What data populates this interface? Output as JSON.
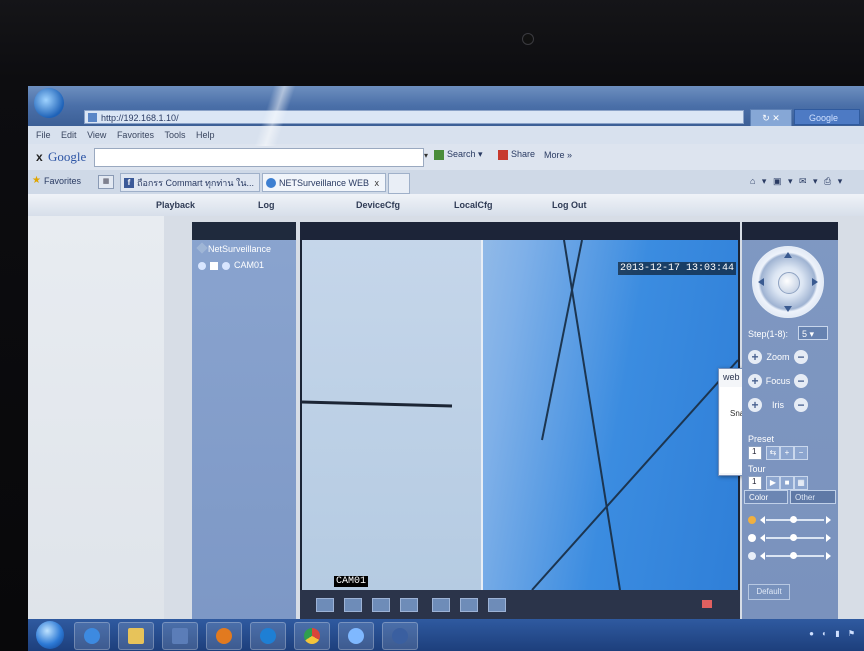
{
  "browser": {
    "address": "http://192.168.1.10/",
    "menu": [
      "File",
      "Edit",
      "View",
      "Favorites",
      "Tools",
      "Help"
    ],
    "search_box": "Google",
    "google_toolbar": {
      "close": "x",
      "logo": "Google",
      "search_label": "Search",
      "share_label": "Share",
      "more_label": "More »"
    },
    "favorites_label": "Favorites",
    "tabs": [
      {
        "label": "ถือกรร Commart ทุกท่าน ใน..."
      },
      {
        "label": "NETSurveillance WEB",
        "close": "x"
      }
    ]
  },
  "app": {
    "nav": [
      "Playback",
      "Log",
      "DeviceCfg",
      "LocalCfg",
      "Log Out"
    ],
    "device_tree": {
      "title": "NetSurveillance",
      "camera": "CAM01"
    },
    "video": {
      "timestamp": "2013-12-17 13:03:44",
      "camera_label": "CAM01"
    },
    "dialog": {
      "title": "web",
      "close": "X",
      "message": "Snapshot failed",
      "ok_label": "OK"
    },
    "ptz": {
      "step_label": "Step(1-8):",
      "step_value": "5",
      "zoom_label": "Zoom",
      "focus_label": "Focus",
      "iris_label": "Iris",
      "preset_label": "Preset",
      "preset_value": "1",
      "tour_label": "Tour",
      "tour_value": "1",
      "color_tab": "Color",
      "other_tab": "Other",
      "default_label": "Default"
    }
  },
  "icons": [
    "ie-logo-icon",
    "facebook-icon",
    "ie-tab-icon",
    "play-icon",
    "record-icon",
    "ptz-arrow-icon",
    "plus-icon",
    "minus-icon",
    "start-orb-icon",
    "firefox-icon",
    "chrome-icon",
    "volume-icon"
  ],
  "colors": {
    "titlebar": "#4a6fa8",
    "panel_blue": "#7f98c2",
    "dialog_close": "#c9453b"
  }
}
